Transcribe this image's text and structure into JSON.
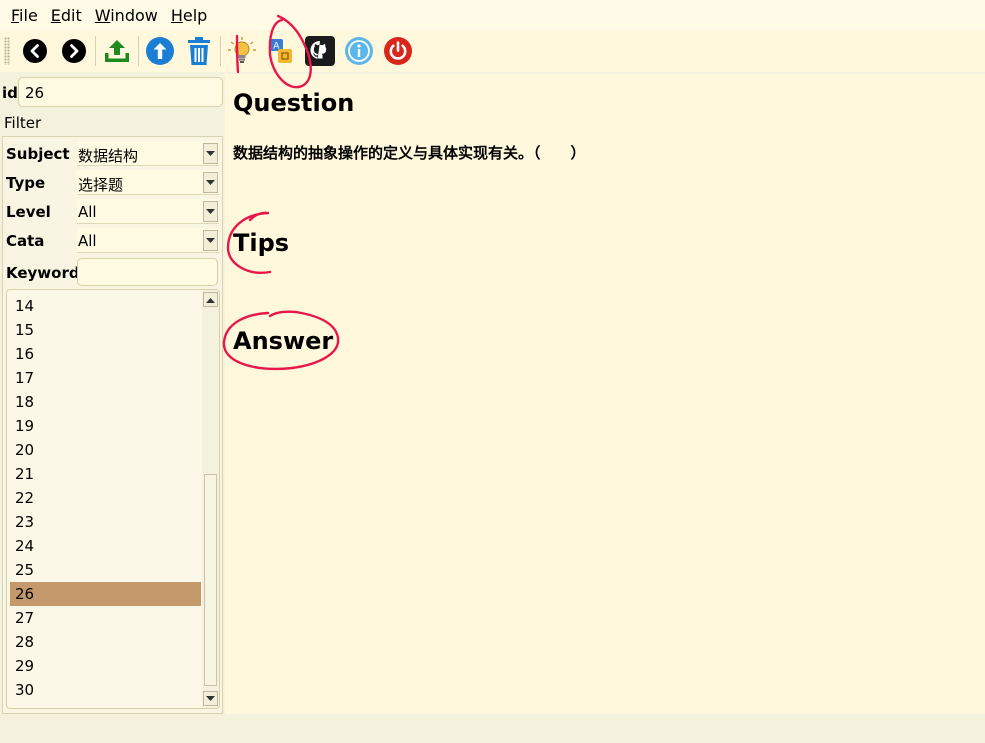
{
  "menu": {
    "file": {
      "mnemonic": "F",
      "rest": "ile"
    },
    "edit": {
      "mnemonic": "E",
      "rest": "dit"
    },
    "window": {
      "mnemonic": "W",
      "rest": "indow"
    },
    "help": {
      "mnemonic": "H",
      "rest": "elp"
    }
  },
  "toolbar": {
    "icons": [
      "arrow-left-icon",
      "arrow-right-icon",
      "upload-icon",
      "arrow-up-icon",
      "trash-icon",
      "lightbulb-icon",
      "translate-icon",
      "github-icon",
      "info-icon",
      "power-icon"
    ]
  },
  "id_field": {
    "label": "id",
    "value": "26"
  },
  "filter": {
    "title": "Filter",
    "subject": {
      "label": "Subject",
      "value": "数据结构"
    },
    "type": {
      "label": "Type",
      "value": "选择题"
    },
    "level": {
      "label": "Level",
      "value": "All"
    },
    "cata": {
      "label": "Cata",
      "value": "All"
    },
    "keyword": {
      "label": "Keyword",
      "value": ""
    }
  },
  "list": {
    "items": [
      "14",
      "15",
      "16",
      "17",
      "18",
      "19",
      "20",
      "21",
      "22",
      "23",
      "24",
      "25",
      "26",
      "27",
      "28",
      "29",
      "30"
    ],
    "selected": "26"
  },
  "content": {
    "question_heading": "Question",
    "question_text": "数据结构的抽象操作的定义与具体实现有关。（　　）",
    "tips_heading": "Tips",
    "answer_heading": "Answer"
  },
  "colors": {
    "background": "#fff8dc",
    "selection": "#c49a6c",
    "annotation": "#e8174a"
  }
}
